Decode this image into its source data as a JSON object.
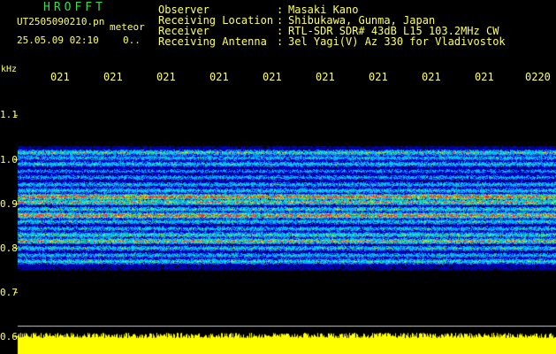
{
  "header": {
    "app_title": "HROFFT",
    "file_name": "UT2505090210.pn",
    "mode": "meteor",
    "datetime": "25.05.09 02:10",
    "mark": "0..",
    "fields": [
      {
        "label": "Observer",
        "sep": ":",
        "value": "Masaki Kano"
      },
      {
        "label": "Receiving Location",
        "sep": ":",
        "value": "Shibukawa, Gunma, Japan"
      },
      {
        "label": "Receiver",
        "sep": ":",
        "value": "RTL-SDR SDR# 43dB L15 103.2MHz CW"
      },
      {
        "label": "Receiving Antenna",
        "sep": ":",
        "value": "3el Yagi(V) Az 330 for Vladivostok"
      }
    ]
  },
  "axes": {
    "y_unit": "kHz",
    "y_ticks": [
      "1.1",
      "1.0",
      "0.9",
      "0.8",
      "0.7",
      "0.6"
    ],
    "x_ticks": [
      "021",
      "021",
      "021",
      "021",
      "021",
      "021",
      "021",
      "021",
      "021",
      "0220"
    ]
  },
  "colors": {
    "text": "#ffff66",
    "title": "#3bd94b",
    "background": "#000000",
    "signal_strip": "#ffff00"
  }
}
